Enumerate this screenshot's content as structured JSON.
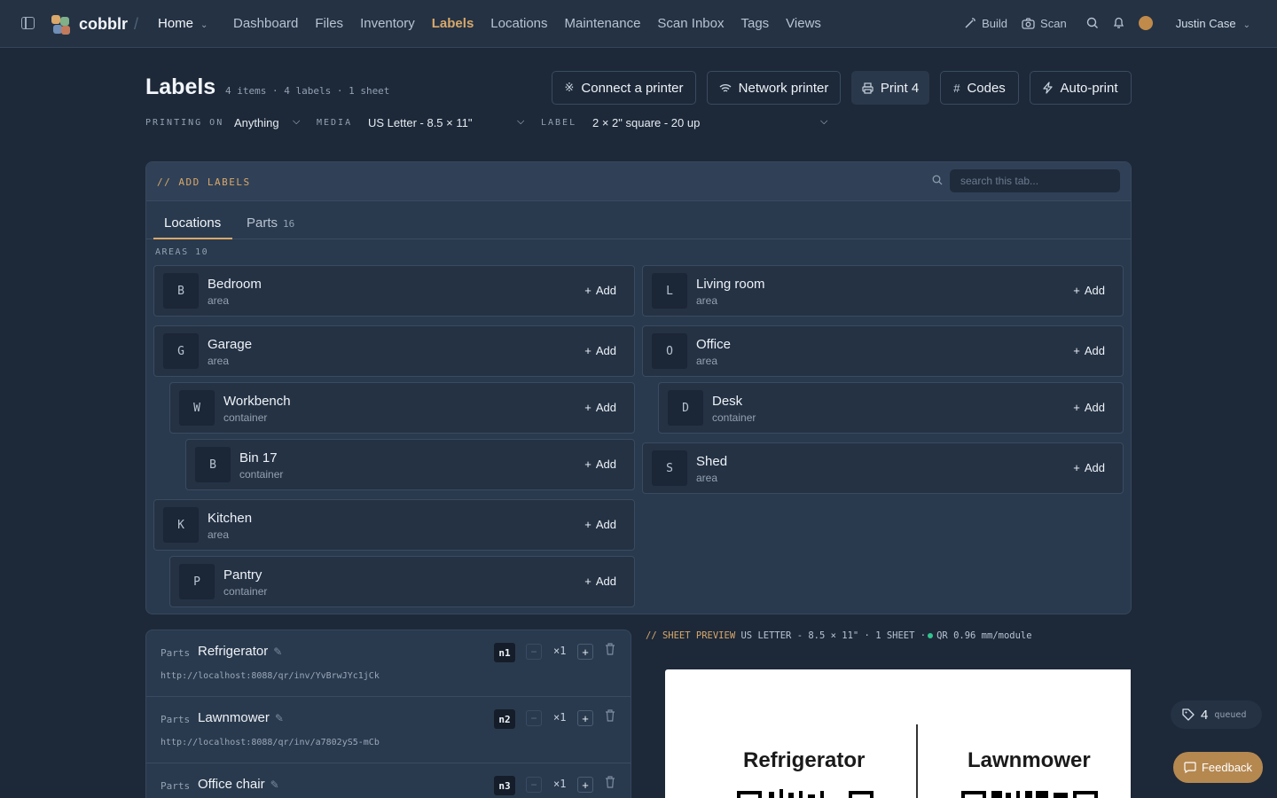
{
  "app": {
    "brand": "cobblr",
    "workspace": "Home",
    "nav": [
      "Dashboard",
      "Files",
      "Inventory",
      "Labels",
      "Locations",
      "Maintenance",
      "Scan Inbox",
      "Tags",
      "Views"
    ],
    "nav_active": "Labels",
    "tools": {
      "build": "Build",
      "scan": "Scan"
    },
    "user": "Justin Case"
  },
  "page": {
    "title": "Labels",
    "subtitle": "4 items · 4 labels · 1 sheet",
    "buttons": {
      "connect": "Connect a printer",
      "network": "Network printer",
      "print": "Print 4",
      "codes": "Codes",
      "autoprint": "Auto-print"
    },
    "options": {
      "printing_on_label": "PRINTING ON",
      "printing_on_value": "Anything",
      "media_label": "MEDIA",
      "media_value": "US Letter - 8.5 × 11\"",
      "label_label": "LABEL",
      "label_value": "2 × 2\" square - 20 up"
    }
  },
  "add_panel": {
    "title": "// ADD LABELS",
    "search_placeholder": "search this tab...",
    "tabs": [
      {
        "label": "Locations",
        "count": ""
      },
      {
        "label": "Parts",
        "count": "16"
      }
    ],
    "areas_label": "AREAS 10",
    "add_label": "Add",
    "locations": [
      {
        "letter": "B",
        "name": "Bedroom",
        "kind": "area"
      },
      {
        "letter": "L",
        "name": "Living room",
        "kind": "area"
      },
      {
        "letter": "G",
        "name": "Garage",
        "kind": "area"
      },
      {
        "letter": "O",
        "name": "Office",
        "kind": "area"
      },
      {
        "letter": "W",
        "name": "Workbench",
        "kind": "container"
      },
      {
        "letter": "D",
        "name": "Desk",
        "kind": "container"
      },
      {
        "letter": "B",
        "name": "Bin 17",
        "kind": "container"
      },
      {
        "letter": "S",
        "name": "Shed",
        "kind": "area"
      },
      {
        "letter": "K",
        "name": "Kitchen",
        "kind": "area"
      },
      {
        "letter": "P",
        "name": "Pantry",
        "kind": "container"
      }
    ]
  },
  "queue": [
    {
      "type": "Parts",
      "name": "Refrigerator",
      "url": "http://localhost:8088/qr/inv/YvBrwJYc1jCk",
      "n": "n1",
      "qty": "×1"
    },
    {
      "type": "Parts",
      "name": "Lawnmower",
      "url": "http://localhost:8088/qr/inv/a7802yS5-mCb",
      "n": "n2",
      "qty": "×1"
    },
    {
      "type": "Parts",
      "name": "Office chair",
      "url": "",
      "n": "n3",
      "qty": "×1"
    }
  ],
  "preview": {
    "title": "// SHEET PREVIEW",
    "info": "US LETTER - 8.5 × 11\" · 1 SHEET ·",
    "qr_info": "QR 0.96 mm/module",
    "labels": [
      "Refrigerator",
      "Lawnmower"
    ]
  },
  "floating": {
    "queued_count": "4",
    "queued_text": "queued",
    "feedback": "Feedback"
  },
  "colors": {
    "accent": "#d9a86a",
    "background": "#1d2939",
    "panel": "#2a3a4e",
    "status_ok": "#31c48d"
  }
}
